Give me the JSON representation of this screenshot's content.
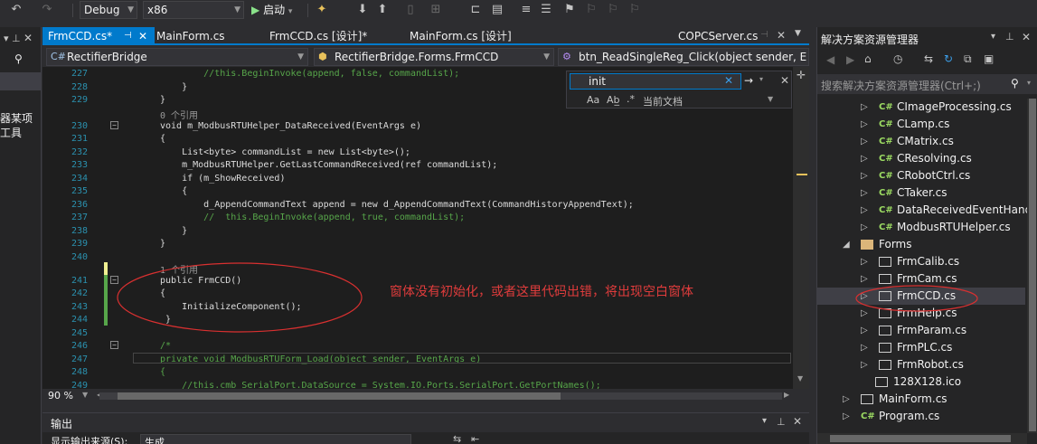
{
  "toolbar": {
    "config": "Debug",
    "platform": "x86",
    "start_label": "启动"
  },
  "left_strip": {
    "line1": "器某项",
    "line2": "工具"
  },
  "tabs": [
    {
      "label": "FrmCCD.cs*"
    },
    {
      "label": "MainForm.cs"
    },
    {
      "label": "FrmCCD.cs [设计]*"
    },
    {
      "label": "MainForm.cs [设计]"
    },
    {
      "label": "COPCServer.cs"
    }
  ],
  "nav": {
    "project": "RectifierBridge",
    "class": "RectifierBridge.Forms.FrmCCD",
    "member": "btn_ReadSingleReg_Click(object sender, E"
  },
  "find": {
    "value": "init",
    "scope": "当前文档"
  },
  "code_lines": [
    {
      "n": "227",
      "text": "        //this.BeginInvoke(append, false, commandList);"
    },
    {
      "n": "228",
      "text": "    }"
    },
    {
      "n": "229",
      "text": "}"
    },
    {
      "n": "230",
      "text": "void m_ModbusRTUHelper_DataReceived(EventArgs e)"
    },
    {
      "n": "231",
      "text": "{"
    },
    {
      "n": "232",
      "text": "    List<byte> commandList = new List<byte>();"
    },
    {
      "n": "233",
      "text": "    m_ModbusRTUHelper.GetLastCommandReceived(ref commandList);"
    },
    {
      "n": "234",
      "text": "    if (m_ShowReceived)"
    },
    {
      "n": "235",
      "text": "    {"
    },
    {
      "n": "236",
      "text": "        d_AppendCommandText append = new d_AppendCommandText(CommandHistoryAppendText);"
    },
    {
      "n": "237",
      "text": "        //  this.BeginInvoke(append, true, commandList);"
    },
    {
      "n": "238",
      "text": "    }"
    },
    {
      "n": "239",
      "text": "}"
    },
    {
      "n": "240",
      "text": ""
    },
    {
      "n": "241",
      "text": "public FrmCCD()"
    },
    {
      "n": "242",
      "text": "{"
    },
    {
      "n": "243",
      "text": "    InitializeComponent();"
    },
    {
      "n": "244",
      "text": " }"
    },
    {
      "n": "245",
      "text": ""
    },
    {
      "n": "246",
      "text": "/*"
    },
    {
      "n": "247",
      "text": "private void ModbusRTUForm_Load(object sender, EventArgs e)"
    },
    {
      "n": "248",
      "text": "{"
    },
    {
      "n": "249",
      "text": "    //this.cmb_SerialPort.DataSource = System.IO.Ports.SerialPort.GetPortNames();"
    }
  ],
  "refs": {
    "ref_230": "0 个引用",
    "ref_241": "1 个引用"
  },
  "annotation": "窗体没有初始化，或者这里代码出错，将出现空白窗体",
  "zoom": "90 %",
  "output": {
    "title": "输出",
    "source_label": "显示输出来源(S):",
    "source_value": "生成"
  },
  "solution": {
    "title": "解决方案资源管理器",
    "search_placeholder": "搜索解决方案资源管理器(Ctrl+;)",
    "items": [
      {
        "label": "CImageProcessing.cs",
        "type": "cs"
      },
      {
        "label": "CLamp.cs",
        "type": "cs"
      },
      {
        "label": "CMatrix.cs",
        "type": "cs"
      },
      {
        "label": "CResolving.cs",
        "type": "cs"
      },
      {
        "label": "CRobotCtrl.cs",
        "type": "cs"
      },
      {
        "label": "CTaker.cs",
        "type": "cs"
      },
      {
        "label": "DataReceivedEventHand",
        "type": "cs"
      },
      {
        "label": "ModbusRTUHelper.cs",
        "type": "cs"
      },
      {
        "label": "Forms",
        "type": "folder"
      },
      {
        "label": "FrmCalib.cs",
        "type": "form"
      },
      {
        "label": "FrmCam.cs",
        "type": "form"
      },
      {
        "label": "FrmCCD.cs",
        "type": "form"
      },
      {
        "label": "FrmHelp.cs",
        "type": "form"
      },
      {
        "label": "FrmParam.cs",
        "type": "form"
      },
      {
        "label": "FrmPLC.cs",
        "type": "form"
      },
      {
        "label": "FrmRobot.cs",
        "type": "form"
      },
      {
        "label": "128X128.ico",
        "type": "ico"
      },
      {
        "label": "MainForm.cs",
        "type": "form"
      },
      {
        "label": "Program.cs",
        "type": "cs"
      }
    ]
  },
  "colors": {
    "accent": "#007acc",
    "annotation_red": "#e03c3c"
  }
}
